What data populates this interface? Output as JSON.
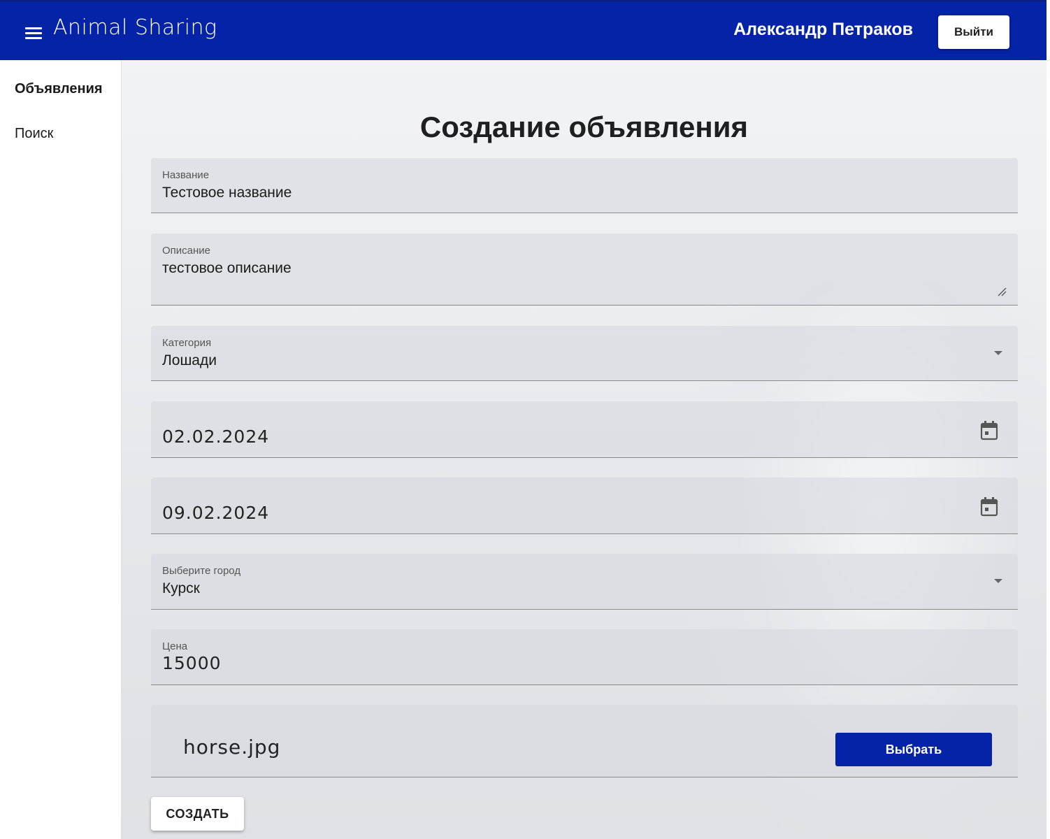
{
  "appbar": {
    "title": "Animal Sharing",
    "user_name": "Александр Петраков",
    "logout_label": "Выйти"
  },
  "sidebar": {
    "items": [
      {
        "label": "Объявления",
        "active": true
      },
      {
        "label": "Поиск",
        "active": false
      }
    ]
  },
  "main": {
    "title": "Создание объявления",
    "fields": {
      "name": {
        "label": "Название",
        "value": "Тестовое название"
      },
      "description": {
        "label": "Описание",
        "value": "тестовое описание"
      },
      "category": {
        "label": "Категория",
        "value": "Лошади"
      },
      "date_start": {
        "value": "02.02.2024"
      },
      "date_end": {
        "value": "09.02.2024"
      },
      "city": {
        "label": "Выберите город",
        "value": "Курск"
      },
      "price": {
        "label": "Цена",
        "value": "15000"
      },
      "file": {
        "value": "horse.jpg",
        "button_label": "Выбрать"
      }
    },
    "create_label": "СОЗДАТЬ"
  },
  "colors": {
    "primary": "#0523a6"
  },
  "icons": {
    "menu": "menu-icon",
    "dropdown": "chevron-down-icon",
    "calendar": "calendar-icon",
    "resize": "resize-handle-icon"
  }
}
